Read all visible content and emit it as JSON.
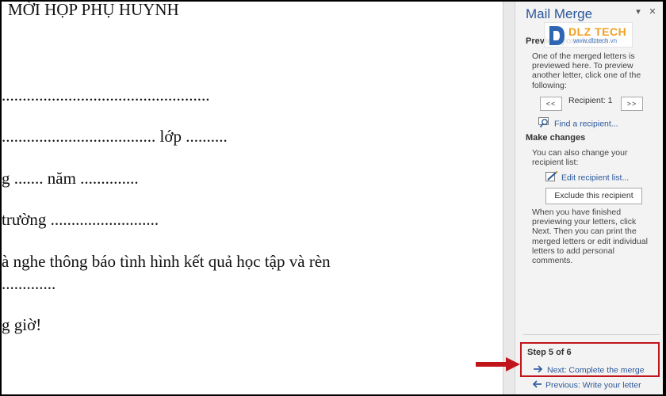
{
  "document": {
    "lines": [
      "MỜI HỌP PHỤ HUYNH",
      "..................................................",
      "..................................... lớp ..........",
      "g ....... năm ..............",
      "trường ..........................",
      "à nghe thông báo tình hình kết quả học tập và rèn",
      " .............",
      "g giờ!"
    ]
  },
  "pane": {
    "title": "Mail Merge",
    "dropdown_glyph": "▾",
    "close_glyph": "✕",
    "preview_heading": "Preview your letters",
    "preview_text": "One of the merged letters is previewed here. To preview another letter, click one of the following:",
    "prev_recipient_label": "<<",
    "recipient_label": "Recipient: 1",
    "next_recipient_label": ">>",
    "find_recipient": "Find a recipient...",
    "make_changes_heading": "Make changes",
    "make_changes_text": "You can also change your recipient list:",
    "edit_recipient_list": "Edit recipient list...",
    "exclude_recipient": "Exclude this recipient",
    "finish_text": "When you have finished previewing your letters, click Next. Then you can print the merged letters or edit individual letters to add personal comments.",
    "step_label": "Step 5 of 6",
    "next_link": "Next: Complete the merge",
    "prev_link": "Previous: Write your letter"
  },
  "logo": {
    "brand": "DLZ TECH",
    "tagline": "www.dlztech.vn"
  },
  "colors": {
    "accent": "#2b579a",
    "highlight_red": "#c0161b",
    "logo_orange": "#f0a020"
  }
}
